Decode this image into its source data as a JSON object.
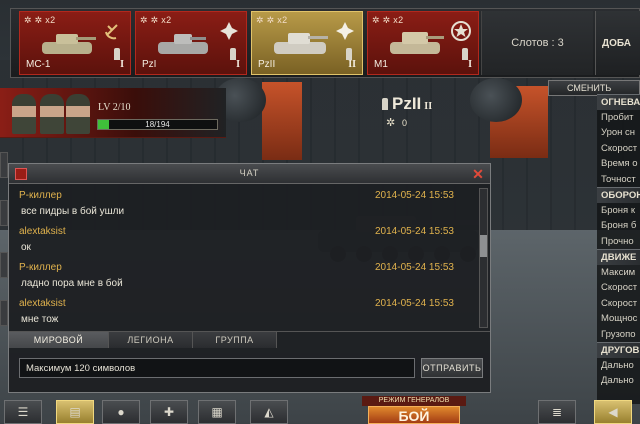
{
  "garage": {
    "slots": [
      {
        "name": "МС-1",
        "tier": "I",
        "meta": "✲ ✲ x2",
        "emblem": "hammer-sickle",
        "selected": false
      },
      {
        "name": "PzI",
        "tier": "I",
        "meta": "✲ ✲ x2",
        "emblem": "iron-cross",
        "selected": false
      },
      {
        "name": "PzII",
        "tier": "II",
        "meta": "✲ ✲ x2",
        "emblem": "iron-cross",
        "selected": true
      },
      {
        "name": "M1",
        "tier": "I",
        "meta": "✲ ✲ x2",
        "emblem": "us-star",
        "selected": false
      }
    ],
    "slots_label": "Слотов : 3",
    "buy_slot_label": "ДОБА"
  },
  "player": {
    "level_label": "LV 2/10",
    "xp_text": "18/194",
    "xp_fraction": 0.093
  },
  "tank": {
    "name": "PzII",
    "tier": "II",
    "count": "0"
  },
  "stats_panel": {
    "change_label": "СМЕНИТЬ",
    "rows": [
      {
        "label": "ОГНЕВА",
        "head": true
      },
      {
        "label": "Пробит",
        "head": false
      },
      {
        "label": "Урон сн",
        "head": false
      },
      {
        "label": "Скорост",
        "head": false
      },
      {
        "label": "Время о",
        "head": false
      },
      {
        "label": "Точност",
        "head": false
      },
      {
        "label": "ОБОРОН",
        "head": true
      },
      {
        "label": "Броня к",
        "head": false
      },
      {
        "label": "Броня б",
        "head": false
      },
      {
        "label": "Прочно",
        "head": false
      },
      {
        "label": "ДВИЖЕ",
        "head": true
      },
      {
        "label": "Максим",
        "head": false
      },
      {
        "label": "Скорост",
        "head": false
      },
      {
        "label": "Скорост",
        "head": false
      },
      {
        "label": "Мощнос",
        "head": false
      },
      {
        "label": "Грузопо",
        "head": false
      },
      {
        "label": "ДРУГОВ",
        "head": true
      },
      {
        "label": "Дально",
        "head": false
      },
      {
        "label": "Дально",
        "head": false
      }
    ]
  },
  "chat": {
    "title": "ЧАТ",
    "messages": [
      {
        "author": "Р-киллер",
        "time": "2014-05-24 15:53",
        "text": "все пидры в бой ушли"
      },
      {
        "author": "alextaksist",
        "time": "2014-05-24 15:53",
        "text": "ок"
      },
      {
        "author": "Р-киллер",
        "time": "2014-05-24 15:53",
        "text": "ладно пора мне в бой"
      },
      {
        "author": "alextaksist",
        "time": "2014-05-24 15:53",
        "text": "мне тож"
      }
    ],
    "tabs": [
      {
        "label": "МИРОВОЙ",
        "active": true
      },
      {
        "label": "ЛЕГИОНА",
        "active": false
      },
      {
        "label": "ГРУППА",
        "active": false
      }
    ],
    "input_placeholder": "Максимум 120 символов",
    "send_label": "ОТПРАВИТЬ"
  },
  "battle": {
    "mode_label": "РЕЖИМ ГЕНЕРАЛОВ",
    "button_label": "БОЙ"
  }
}
